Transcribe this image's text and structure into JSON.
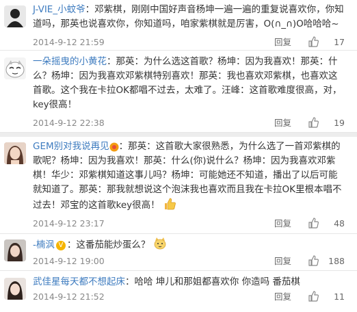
{
  "reply_label": "回复",
  "comments": [
    {
      "user": "J-VIE_小蚊爷",
      "colon": "：",
      "text": "邓紫棋，刚刚中国好声音杨坤一遍一遍的重复说喜欢你，你知道吗，那英也说喜欢你，你知道吗，咱家紫棋就是厉害，O(∩_∩)O哈哈哈~",
      "time": "2014-9-12 21:59",
      "likes": "17",
      "avatar_icon": "dark-silhouette-avatar"
    },
    {
      "user": "一朵摇曳的小黄花",
      "colon": "：",
      "text": "那英：为什么选这首歌？杨坤：因为我喜欢！那英：什么？杨坤：因为我喜欢邓紫棋特别喜欢！那英：我也喜欢邓紫棋，也喜欢这首歌。这个我在卡拉OK都唱不过去，太难了。汪峰：这首歌难度很高，对，key很高！",
      "time": "2014-9-12 22:38",
      "likes": "19",
      "avatar_icon": "cartoon-face-avatar"
    },
    {
      "user": "GEM别对我说再见",
      "colon": "：",
      "text": "那英：这首歌大家很熟悉，为什么选了一首邓紫棋的歌呢？杨坤：因为我喜欢！那英：什么(你)说什么？杨坤：因为我喜欢邓紫棋！华少：邓紫棋知道这事儿吗？杨坤：可能她还不知道，播出了以后可能就知道了。那英：那我就想说这个泡沫我也喜欢而且我在卡拉OK里根本唱不过去！邓宝的这首歌key很高！",
      "time": "2014-9-12 23:17",
      "likes": "48",
      "avatar_icon": "girl-portrait-avatar"
    },
    {
      "user": "-楠沨",
      "colon": "：",
      "text": "这番茄能炒蛋么？",
      "time": "2014-9-12 19:00",
      "likes": "188",
      "avatar_icon": "girl-photo-avatar"
    },
    {
      "user": "武佳星每天都不想起床",
      "colon": "：",
      "text": "哈哈 坤儿和那姐都喜欢你 你造吗 番茄棋",
      "time": "2014-9-12 21:52",
      "likes": "11",
      "avatar_icon": "girl-photo-avatar-2"
    }
  ],
  "colors": {
    "link": "#3d7bbf",
    "text": "#333333",
    "meta": "#888888",
    "band": "#ededed"
  }
}
